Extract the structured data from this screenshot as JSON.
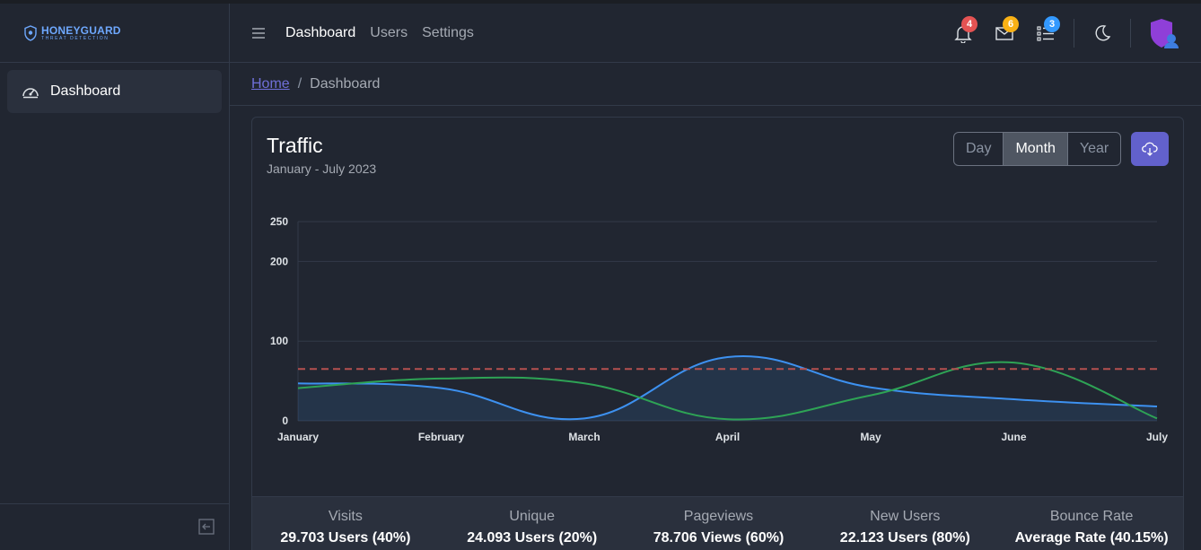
{
  "brand": {
    "name": "HONEYGUARD",
    "tagline": "THREAT DETECTION",
    "color": "#6ea8fe"
  },
  "sidebar": {
    "items": [
      {
        "label": "Dashboard",
        "icon": "speedometer-icon",
        "active": true
      }
    ],
    "collapse_icon": "collapse-left-icon"
  },
  "header": {
    "nav": [
      {
        "label": "Dashboard",
        "active": true
      },
      {
        "label": "Users",
        "active": false
      },
      {
        "label": "Settings",
        "active": false
      }
    ],
    "notifications": {
      "count": "4",
      "color": "#e55353"
    },
    "messages": {
      "count": "6",
      "color": "#f9b115"
    },
    "tasks": {
      "count": "3",
      "color": "#3399ff"
    },
    "theme_icon": "moon-icon"
  },
  "breadcrumb": {
    "home": "Home",
    "separator": "/",
    "current": "Dashboard"
  },
  "traffic": {
    "title": "Traffic",
    "subtitle": "January - July 2023",
    "range_buttons": [
      "Day",
      "Month",
      "Year"
    ],
    "selected_range": "Month",
    "download_icon": "cloud-download-icon"
  },
  "chart_data": {
    "type": "line",
    "categories": [
      "January",
      "February",
      "March",
      "April",
      "May",
      "June",
      "July"
    ],
    "yticks": [
      0,
      100,
      200,
      250
    ],
    "ylim": [
      0,
      250
    ],
    "grid": true,
    "series": [
      {
        "color": "#3d91f0",
        "fill": true,
        "values": [
          47,
          41,
          3,
          80,
          42,
          27,
          18
        ]
      },
      {
        "color": "#2ea355",
        "fill": false,
        "values": [
          41,
          53,
          47,
          2,
          32,
          73,
          3
        ]
      },
      {
        "color": "#b45050",
        "dashed": true,
        "values": [
          65,
          65,
          65,
          65,
          65,
          65,
          65
        ]
      }
    ]
  },
  "stats": [
    {
      "label": "Visits",
      "value": "29.703 Users (40%)"
    },
    {
      "label": "Unique",
      "value": "24.093 Users (20%)"
    },
    {
      "label": "Pageviews",
      "value": "78.706 Views (60%)"
    },
    {
      "label": "New Users",
      "value": "22.123 Users (80%)"
    },
    {
      "label": "Bounce Rate",
      "value": "Average Rate (40.15%)"
    }
  ]
}
